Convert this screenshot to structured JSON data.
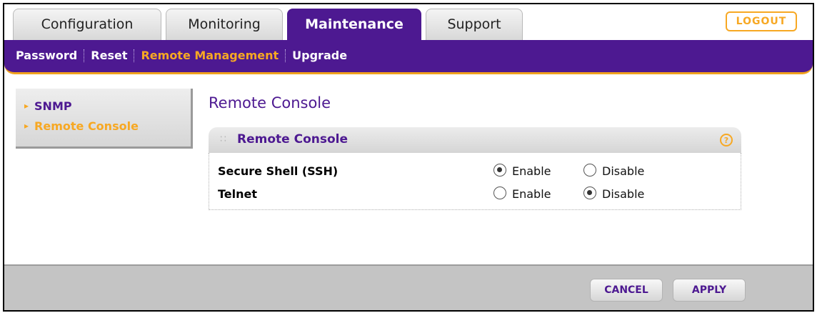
{
  "tabs": {
    "configuration": "Configuration",
    "monitoring": "Monitoring",
    "maintenance": "Maintenance",
    "support": "Support"
  },
  "logout_label": "LOGOUT",
  "submenu": {
    "password": "Password",
    "reset": "Reset",
    "remote_management": "Remote Management",
    "upgrade": "Upgrade"
  },
  "sidemenu": {
    "snmp": "SNMP",
    "remote_console": "Remote Console"
  },
  "page_title": "Remote Console",
  "panel": {
    "title": "Remote Console",
    "help_icon_text": "?",
    "rows": [
      {
        "label": "Secure Shell (SSH)",
        "enable_label": "Enable",
        "disable_label": "Disable",
        "selected": "Enable"
      },
      {
        "label": "Telnet",
        "enable_label": "Enable",
        "disable_label": "Disable",
        "selected": "Disable"
      }
    ]
  },
  "buttons": {
    "cancel": "CANCEL",
    "apply": "APPLY"
  },
  "colors": {
    "brand_purple": "#4d1991",
    "accent_orange": "#f7a823",
    "footer_gray": "#c4c4c4"
  }
}
